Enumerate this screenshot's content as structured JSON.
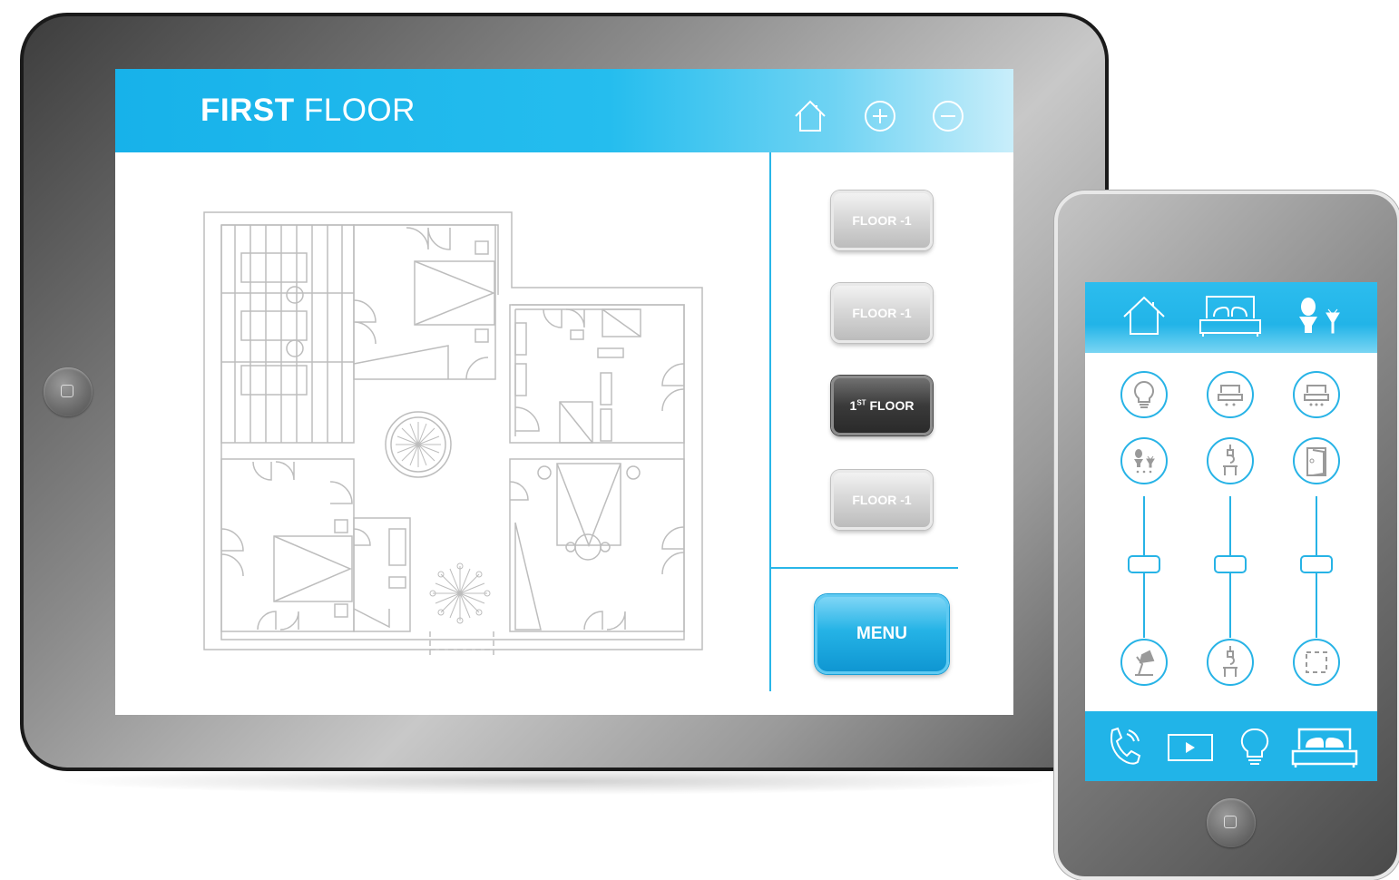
{
  "tablet": {
    "title_bold": "FIRST",
    "title_light": "FLOOR",
    "header_icons": [
      "home-icon",
      "zoom-in-icon",
      "zoom-out-icon"
    ],
    "floor_buttons": [
      {
        "label": "FLOOR -1",
        "active": false
      },
      {
        "label": "FLOOR -1",
        "active": false
      },
      {
        "label_number": "1",
        "label_sup": "ST",
        "label_rest": "FLOOR",
        "active": true
      },
      {
        "label": "FLOOR -1",
        "active": false
      }
    ],
    "menu_label": "MENU"
  },
  "phone": {
    "top_icons": [
      "home-icon",
      "bed-icon",
      "person-plant-icon"
    ],
    "control_icons": [
      "bulb-icon",
      "ceiling-light-icon",
      "ceiling-light-icon",
      "person-plant-icon",
      "pendant-lamp-icon",
      "door-light-icon"
    ],
    "slider_bottom_icons": [
      "desk-lamp-icon",
      "pendant-lamp-icon",
      "window-icon"
    ],
    "bottom_icons": [
      "phone-call-icon",
      "play-icon",
      "bulb-icon",
      "bed-icon"
    ]
  },
  "colors": {
    "accent": "#22b4e8",
    "active_button": "#3a3a3a",
    "device_frame": "#8c8c8c"
  }
}
